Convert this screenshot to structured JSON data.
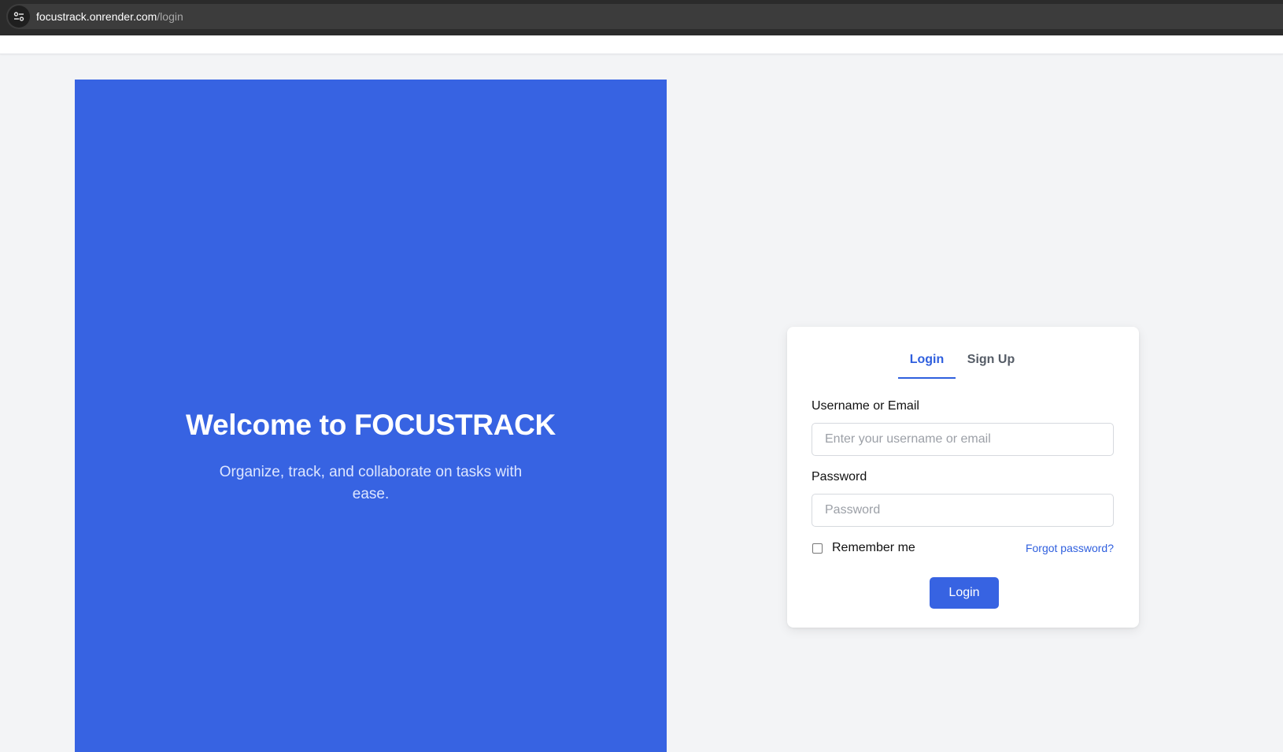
{
  "browser": {
    "url_host": "focustrack.onrender.com",
    "url_path": "/login",
    "site_info_icon": "tune-icon"
  },
  "hero": {
    "title": "Welcome to FOCUSTRACK",
    "subtitle": "Organize, track, and collaborate on tasks with ease.",
    "background_color": "#3763e2"
  },
  "auth_card": {
    "tabs": [
      {
        "label": "Login",
        "active": true
      },
      {
        "label": "Sign Up",
        "active": false
      }
    ],
    "username": {
      "label": "Username or Email",
      "placeholder": "Enter your username or email",
      "value": ""
    },
    "password": {
      "label": "Password",
      "placeholder": "Password",
      "value": ""
    },
    "remember_me": {
      "label": "Remember me",
      "checked": false
    },
    "forgot_password_label": "Forgot password?",
    "submit_label": "Login",
    "accent_color": "#2f5fde"
  }
}
